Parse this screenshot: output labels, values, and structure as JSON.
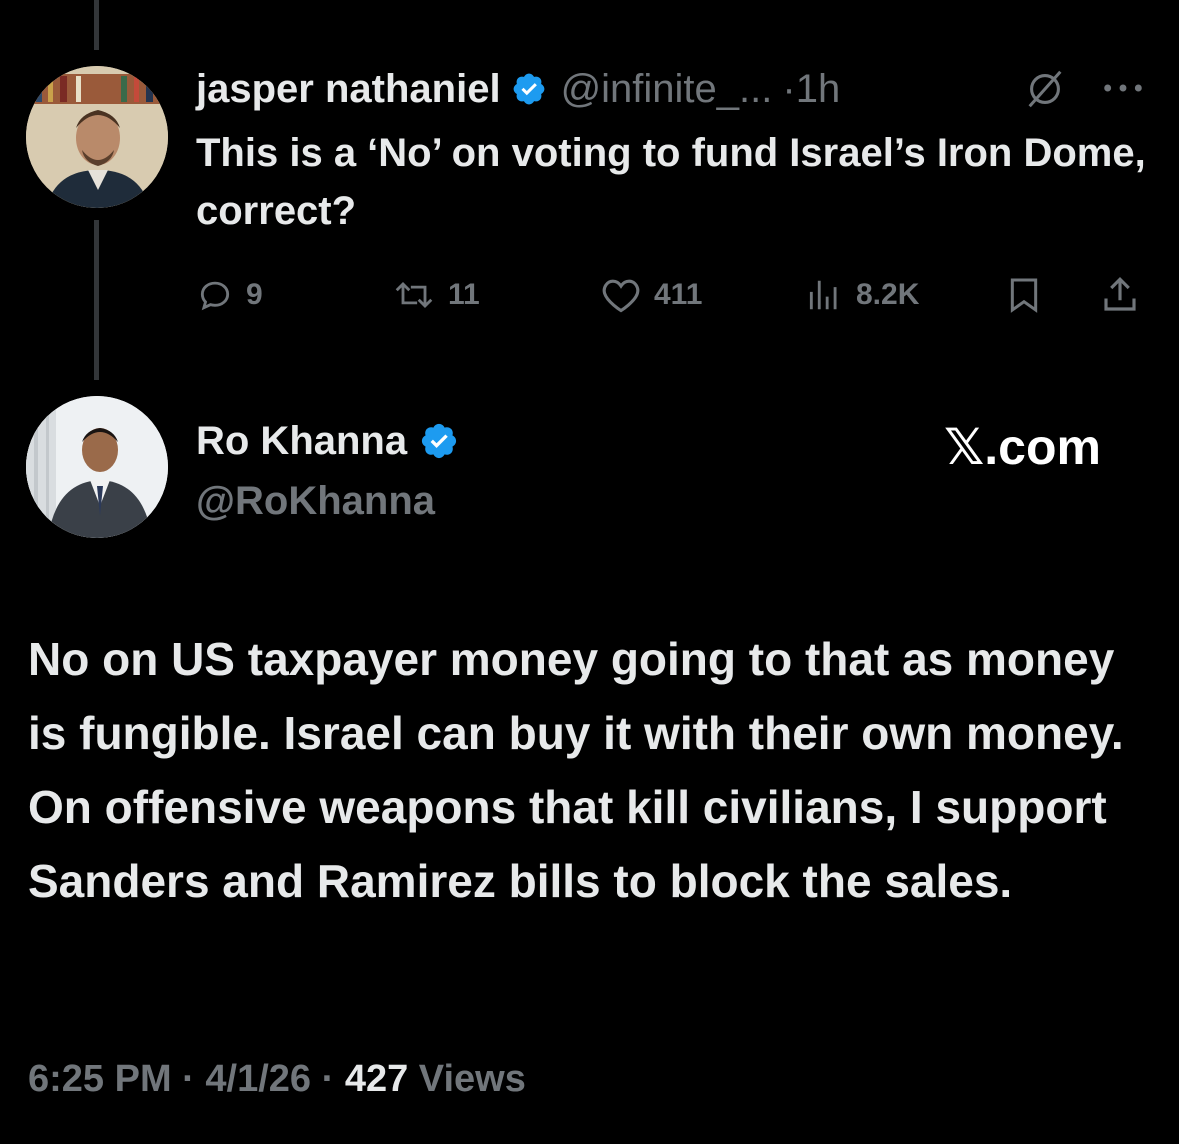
{
  "reply": {
    "author_name": "jasper nathaniel",
    "handle": "@infinite_...",
    "separator": "·",
    "time": "1h",
    "text": "This is a ‘No’ on voting to fund Israel’s Iron Dome, correct?",
    "actions": {
      "replies": "9",
      "reposts": "11",
      "likes": "411",
      "views": "8.2K"
    }
  },
  "main": {
    "author_name": "Ro Khanna",
    "handle": "@RoKhanna",
    "brand": "𝕏.com",
    "text": "No on US taxpayer money going to that as money is fungible. Israel can buy it with their own money.  On offensive weapons that kill civilians, I support Sanders and Ramirez bills to block the sales.",
    "time": "6:25 PM",
    "sep1": " · ",
    "date": "4/1/26",
    "sep2": " · ",
    "views_count": "427",
    "views_label": " Views"
  },
  "colors": {
    "background": "#000000",
    "text": "#e7e9ea",
    "secondary": "#71767b",
    "verified": "#1d9bf0"
  },
  "icons": [
    "verified-badge-icon",
    "grok-icon",
    "more-icon",
    "reply-icon",
    "repost-icon",
    "like-icon",
    "views-icon",
    "bookmark-icon",
    "share-icon"
  ]
}
